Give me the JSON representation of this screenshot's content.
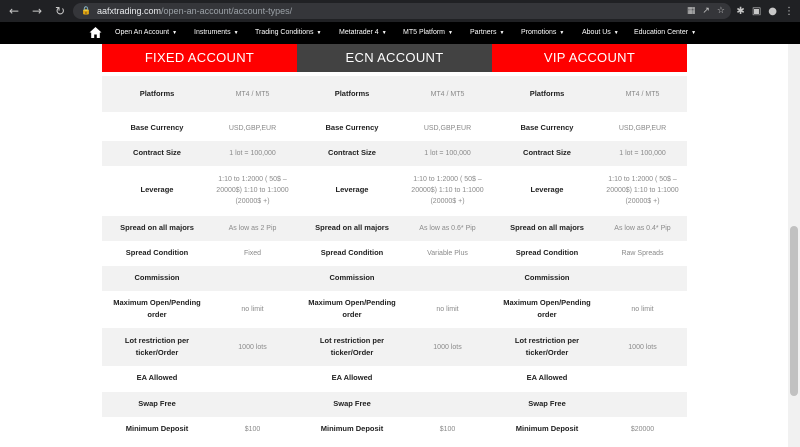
{
  "browser": {
    "url_domain": "aafxtrading.com",
    "url_path": "/open-an-account/account-types/"
  },
  "nav": {
    "items": [
      {
        "label": "Open An Account"
      },
      {
        "label": "Instruments"
      },
      {
        "label": "Trading Conditions"
      },
      {
        "label": "Metatrader 4"
      },
      {
        "label": "MT5 Platform"
      },
      {
        "label": "Partners"
      },
      {
        "label": "Promotions"
      },
      {
        "label": "About Us"
      },
      {
        "label": "Education Center"
      }
    ]
  },
  "colors": {
    "fixed_header": "#ff0000",
    "ecn_header": "#424242",
    "vip_header": "#ff0000"
  },
  "accounts": [
    {
      "title": "FIXED ACCOUNT",
      "rows": [
        {
          "label": "Platforms",
          "value": "MT4 / MT5"
        },
        {
          "label": "Base Currency",
          "value": "USD,GBP,EUR"
        },
        {
          "label": "Contract Size",
          "value": "1 lot = 100,000"
        },
        {
          "label": "Leverage",
          "value": "1:10 to 1:2000 ( 50$ – 20000$) 1:10 to 1:1000 (20000$ +)"
        },
        {
          "label": "Spread on all majors",
          "value": "As low as 2 Pip"
        },
        {
          "label": "Spread Condition",
          "value": "Fixed"
        },
        {
          "label": "Commission",
          "value": ""
        },
        {
          "label": "Maximum Open/Pending order",
          "value": "no limit"
        },
        {
          "label": "Lot restriction per ticker/Order",
          "value": "1000 lots"
        },
        {
          "label": "EA Allowed",
          "value": ""
        },
        {
          "label": "Swap Free",
          "value": ""
        },
        {
          "label": "Minimum Deposit",
          "value": "$100"
        }
      ]
    },
    {
      "title": "ECN ACCOUNT",
      "rows": [
        {
          "label": "Platforms",
          "value": "MT4 / MT5"
        },
        {
          "label": "Base Currency",
          "value": "USD,GBP,EUR"
        },
        {
          "label": "Contract Size",
          "value": "1 lot = 100,000"
        },
        {
          "label": "Leverage",
          "value": "1:10 to 1:2000 ( 50$ – 20000$) 1:10 to 1:1000 (20000$ +)"
        },
        {
          "label": "Spread on all majors",
          "value": "As low as 0.6* Pip"
        },
        {
          "label": "Spread Condition",
          "value": "Variable Plus"
        },
        {
          "label": "Commission",
          "value": ""
        },
        {
          "label": "Maximum Open/Pending order",
          "value": "no limit"
        },
        {
          "label": "Lot restriction per ticker/Order",
          "value": "1000 lots"
        },
        {
          "label": "EA Allowed",
          "value": ""
        },
        {
          "label": "Swap Free",
          "value": ""
        },
        {
          "label": "Minimum Deposit",
          "value": "$100"
        }
      ]
    },
    {
      "title": "VIP ACCOUNT",
      "rows": [
        {
          "label": "Platforms",
          "value": "MT4 / MT5"
        },
        {
          "label": "Base Currency",
          "value": "USD,GBP,EUR"
        },
        {
          "label": "Contract Size",
          "value": "1 lot = 100,000"
        },
        {
          "label": "Leverage",
          "value": "1:10 to 1:2000 ( 50$ – 20000$) 1:10 to 1:1000 (20000$ +)"
        },
        {
          "label": "Spread on all majors",
          "value": "As low as 0.4* Pip"
        },
        {
          "label": "Spread Condition",
          "value": "Raw Spreads"
        },
        {
          "label": "Commission",
          "value": ""
        },
        {
          "label": "Maximum Open/Pending order",
          "value": "no limit"
        },
        {
          "label": "Lot restriction per ticker/Order",
          "value": "1000 lots"
        },
        {
          "label": "EA Allowed",
          "value": ""
        },
        {
          "label": "Swap Free",
          "value": ""
        },
        {
          "label": "Minimum Deposit",
          "value": "$20000"
        }
      ]
    }
  ]
}
